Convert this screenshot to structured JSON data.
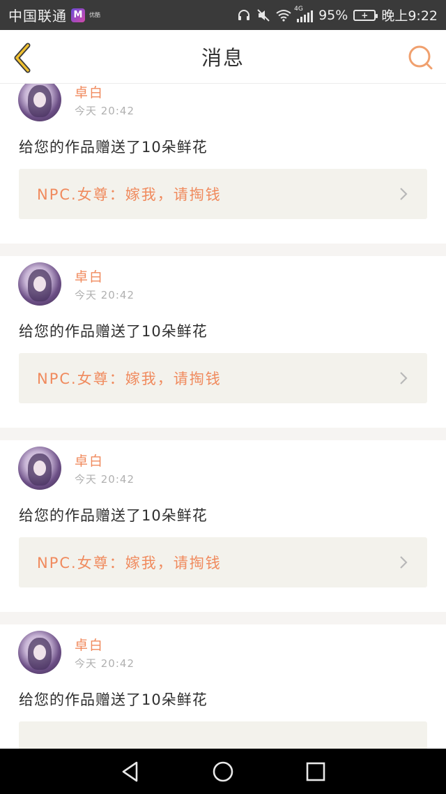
{
  "status_bar": {
    "carrier": "中国联通",
    "app_badge": "M",
    "app_label": "优酷",
    "network": "4G",
    "battery_percent": "95%",
    "time": "晚上9:22"
  },
  "header": {
    "title": "消息",
    "back_icon": "chevron-left-icon",
    "search_icon": "search-icon"
  },
  "colors": {
    "accent": "#f08a5d",
    "back_icon": "#f0c030",
    "quote_bg": "#f3f2ec"
  },
  "messages": [
    {
      "user_name": "卓白",
      "timestamp": "今天 20:42",
      "text": "给您的作品赠送了10朵鲜花",
      "quote": "NPC.女尊：嫁我，请掏钱"
    },
    {
      "user_name": "卓白",
      "timestamp": "今天 20:42",
      "text": "给您的作品赠送了10朵鲜花",
      "quote": "NPC.女尊：嫁我，请掏钱"
    },
    {
      "user_name": "卓白",
      "timestamp": "今天 20:42",
      "text": "给您的作品赠送了10朵鲜花",
      "quote": "NPC.女尊：嫁我，请掏钱"
    },
    {
      "user_name": "卓白",
      "timestamp": "今天 20:42",
      "text": "给您的作品赠送了10朵鲜花",
      "quote": ""
    }
  ],
  "nav_bar": {
    "back_icon": "triangle-back-icon",
    "home_icon": "circle-home-icon",
    "recents_icon": "square-recents-icon"
  }
}
